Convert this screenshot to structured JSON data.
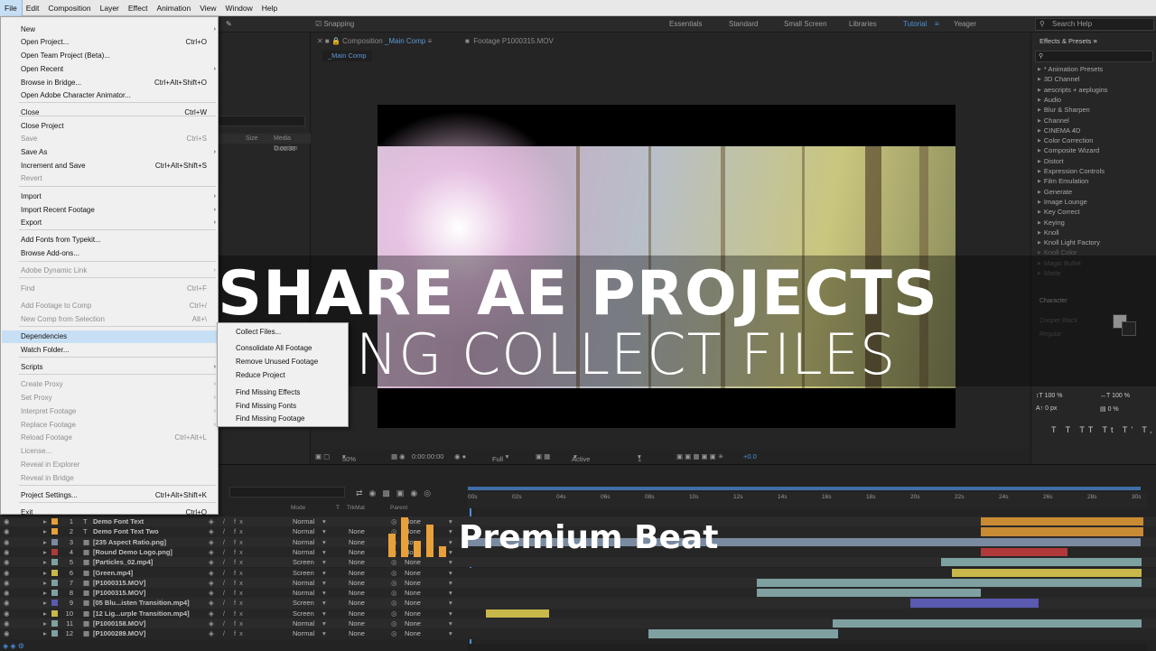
{
  "menubar": {
    "items": [
      "File",
      "Edit",
      "Composition",
      "Layer",
      "Effect",
      "Animation",
      "View",
      "Window",
      "Help"
    ]
  },
  "toolbar": {
    "snapping": "Snapping",
    "workspaces": [
      "Essentials",
      "Standard",
      "Small Screen",
      "Libraries",
      "Tutorial",
      "Yeager"
    ],
    "search_placeholder": "Search Help"
  },
  "file_menu": {
    "items": [
      {
        "label": "New",
        "shortcut": "",
        "arrow": true,
        "disabled": false
      },
      {
        "label": "Open Project...",
        "shortcut": "Ctrl+O",
        "arrow": false,
        "disabled": false
      },
      {
        "label": "Open Team Project (Beta)...",
        "shortcut": "",
        "arrow": false,
        "disabled": false
      },
      {
        "label": "Open Recent",
        "shortcut": "",
        "arrow": true,
        "disabled": false
      },
      {
        "label": "Browse in Bridge...",
        "shortcut": "Ctrl+Alt+Shift+O",
        "arrow": false,
        "disabled": false
      },
      {
        "label": "Open Adobe Character Animator...",
        "shortcut": "",
        "arrow": false,
        "disabled": false
      },
      {
        "label": "Close",
        "shortcut": "Ctrl+W",
        "arrow": false,
        "disabled": false
      },
      {
        "label": "Close Project",
        "shortcut": "",
        "arrow": false,
        "disabled": false
      },
      {
        "label": "Save",
        "shortcut": "Ctrl+S",
        "arrow": false,
        "disabled": true
      },
      {
        "label": "Save As",
        "shortcut": "",
        "arrow": true,
        "disabled": false
      },
      {
        "label": "Increment and Save",
        "shortcut": "Ctrl+Alt+Shift+S",
        "arrow": false,
        "disabled": false
      },
      {
        "label": "Revert",
        "shortcut": "",
        "arrow": false,
        "disabled": true
      },
      {
        "label": "Import",
        "shortcut": "",
        "arrow": true,
        "disabled": false
      },
      {
        "label": "Import Recent Footage",
        "shortcut": "",
        "arrow": true,
        "disabled": false
      },
      {
        "label": "Export",
        "shortcut": "",
        "arrow": true,
        "disabled": false
      },
      {
        "label": "Add Fonts from Typekit...",
        "shortcut": "",
        "arrow": false,
        "disabled": false
      },
      {
        "label": "Browse Add-ons...",
        "shortcut": "",
        "arrow": false,
        "disabled": false
      },
      {
        "label": "Adobe Dynamic Link",
        "shortcut": "",
        "arrow": true,
        "disabled": true
      },
      {
        "label": "Find",
        "shortcut": "Ctrl+F",
        "arrow": false,
        "disabled": true
      },
      {
        "label": "Add Footage to Comp",
        "shortcut": "Ctrl+/",
        "arrow": false,
        "disabled": true
      },
      {
        "label": "New Comp from Selection",
        "shortcut": "Alt+\\",
        "arrow": false,
        "disabled": true
      },
      {
        "label": "Dependencies",
        "shortcut": "",
        "arrow": true,
        "disabled": false,
        "selected": true
      },
      {
        "label": "Watch Folder...",
        "shortcut": "",
        "arrow": false,
        "disabled": false
      },
      {
        "label": "Scripts",
        "shortcut": "",
        "arrow": true,
        "disabled": false
      },
      {
        "label": "Create Proxy",
        "shortcut": "",
        "arrow": true,
        "disabled": true
      },
      {
        "label": "Set Proxy",
        "shortcut": "",
        "arrow": true,
        "disabled": true
      },
      {
        "label": "Interpret Footage",
        "shortcut": "",
        "arrow": true,
        "disabled": true
      },
      {
        "label": "Replace Footage",
        "shortcut": "",
        "arrow": true,
        "disabled": true
      },
      {
        "label": "Reload Footage",
        "shortcut": "Ctrl+Alt+L",
        "arrow": false,
        "disabled": true
      },
      {
        "label": "License...",
        "shortcut": "",
        "arrow": false,
        "disabled": true
      },
      {
        "label": "Reveal in Explorer",
        "shortcut": "",
        "arrow": false,
        "disabled": true
      },
      {
        "label": "Reveal in Bridge",
        "shortcut": "",
        "arrow": false,
        "disabled": true
      },
      {
        "label": "Project Settings...",
        "shortcut": "Ctrl+Alt+Shift+K",
        "arrow": false,
        "disabled": false
      },
      {
        "label": "Exit",
        "shortcut": "Ctrl+Q",
        "arrow": false,
        "disabled": false
      }
    ]
  },
  "dependencies_menu": {
    "items": [
      "Collect Files...",
      "Consolidate All Footage",
      "Remove Unused Footage",
      "Reduce Project",
      "Find Missing Effects",
      "Find Missing Fonts",
      "Find Missing Footage"
    ]
  },
  "project_panel": {
    "col_size": "Size",
    "col_duration": "Media Duration",
    "duration_value": "0:00:30"
  },
  "composition": {
    "tab_prefix": "Composition",
    "tab_name": "_Main Comp",
    "footage_tab": "Footage P1000315.MOV",
    "subtab": "_Main Comp",
    "zoom": "50%",
    "timecode": "0:00:00:00",
    "resolution": "Full",
    "camera": "Active Camera",
    "views": "1 View",
    "exposure": "+0.0"
  },
  "effects_panel": {
    "title": "Effects & Presets",
    "items": [
      "* Animation Presets",
      "3D Channel",
      "aescripts + aeplugins",
      "Audio",
      "Blur & Sharpen",
      "Channel",
      "CINEMA 4D",
      "Color Correction",
      "Composite Wizard",
      "Distort",
      "Expression Controls",
      "Film Emulation",
      "Generate",
      "Image Lounge",
      "Key Correct",
      "Keying",
      "Knoll",
      "Knoll Light Factory",
      "Knoll Color",
      "Magic Bullet",
      "Matte"
    ],
    "character_title": "Character",
    "font_name": "Cooper Black",
    "font_style": "Regular",
    "vscale": "100 %",
    "hscale": "100 %",
    "baseline": "0 px",
    "tsume": "0 %"
  },
  "timeline": {
    "col_mode": "Mode",
    "col_trkmat": "TrkMat",
    "col_parent": "Parent",
    "ticks": [
      "00s",
      "02s",
      "04s",
      "06s",
      "08s",
      "10s",
      "12s",
      "14s",
      "16s",
      "18s",
      "20s",
      "22s",
      "24s",
      "26s",
      "28s",
      "30s"
    ],
    "layers": [
      {
        "num": "1",
        "name": "Demo Font Text",
        "mode": "Normal",
        "trkmat": "",
        "parent": "None",
        "color": "#e8a03a"
      },
      {
        "num": "2",
        "name": "Demo Font Text Two",
        "mode": "Normal",
        "trkmat": "None",
        "parent": "None",
        "color": "#e8a03a"
      },
      {
        "num": "3",
        "name": "[235 Aspect Ratio.png]",
        "mode": "Normal",
        "trkmat": "None",
        "parent": "None",
        "color": "#7a8aa0"
      },
      {
        "num": "4",
        "name": "[Round Demo Logo.png]",
        "mode": "Normal",
        "trkmat": "None",
        "parent": "None",
        "color": "#b03a3a"
      },
      {
        "num": "5",
        "name": "[Particles_02.mp4]",
        "mode": "Screen",
        "trkmat": "None",
        "parent": "None",
        "color": "#7fa0a0"
      },
      {
        "num": "6",
        "name": "[Green.mp4]",
        "mode": "Screen",
        "trkmat": "None",
        "parent": "None",
        "color": "#c8b84a"
      },
      {
        "num": "7",
        "name": "[P1000315.MOV]",
        "mode": "Normal",
        "trkmat": "None",
        "parent": "None",
        "color": "#7fa0a0"
      },
      {
        "num": "8",
        "name": "[P1000315.MOV]",
        "mode": "Normal",
        "trkmat": "None",
        "parent": "None",
        "color": "#7fa0a0"
      },
      {
        "num": "9",
        "name": "[05 Blu...isten Transition.mp4]",
        "mode": "Screen",
        "trkmat": "None",
        "parent": "None",
        "color": "#5a5ab0"
      },
      {
        "num": "10",
        "name": "[12 Lig...urple Transition.mp4]",
        "mode": "Screen",
        "trkmat": "None",
        "parent": "None",
        "color": "#c8b84a"
      },
      {
        "num": "11",
        "name": "[P1000158.MOV]",
        "mode": "Normal",
        "trkmat": "None",
        "parent": "None",
        "color": "#7fa0a0"
      },
      {
        "num": "12",
        "name": "[P1000289.MOV]",
        "mode": "Normal",
        "trkmat": "None",
        "parent": "None",
        "color": "#7fa0a0"
      }
    ]
  },
  "overlay": {
    "title_line1": "SHARE AE PROJECTS",
    "title_line2": "USING COLLECT FILES",
    "brand": "Premium Beat",
    "brand_color": "#e8a03a"
  }
}
